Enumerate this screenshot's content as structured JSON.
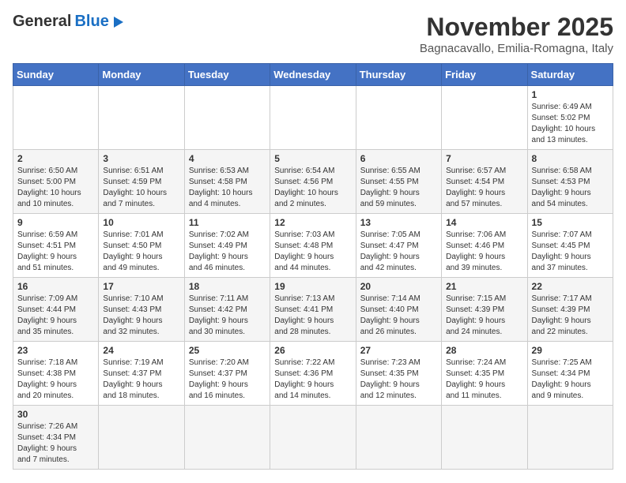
{
  "header": {
    "logo_general": "General",
    "logo_blue": "Blue",
    "month_year": "November 2025",
    "location": "Bagnacavallo, Emilia-Romagna, Italy"
  },
  "weekdays": [
    "Sunday",
    "Monday",
    "Tuesday",
    "Wednesday",
    "Thursday",
    "Friday",
    "Saturday"
  ],
  "weeks": [
    [
      {
        "day": "",
        "info": ""
      },
      {
        "day": "",
        "info": ""
      },
      {
        "day": "",
        "info": ""
      },
      {
        "day": "",
        "info": ""
      },
      {
        "day": "",
        "info": ""
      },
      {
        "day": "",
        "info": ""
      },
      {
        "day": "1",
        "info": "Sunrise: 6:49 AM\nSunset: 5:02 PM\nDaylight: 10 hours\nand 13 minutes."
      }
    ],
    [
      {
        "day": "2",
        "info": "Sunrise: 6:50 AM\nSunset: 5:00 PM\nDaylight: 10 hours\nand 10 minutes."
      },
      {
        "day": "3",
        "info": "Sunrise: 6:51 AM\nSunset: 4:59 PM\nDaylight: 10 hours\nand 7 minutes."
      },
      {
        "day": "4",
        "info": "Sunrise: 6:53 AM\nSunset: 4:58 PM\nDaylight: 10 hours\nand 4 minutes."
      },
      {
        "day": "5",
        "info": "Sunrise: 6:54 AM\nSunset: 4:56 PM\nDaylight: 10 hours\nand 2 minutes."
      },
      {
        "day": "6",
        "info": "Sunrise: 6:55 AM\nSunset: 4:55 PM\nDaylight: 9 hours\nand 59 minutes."
      },
      {
        "day": "7",
        "info": "Sunrise: 6:57 AM\nSunset: 4:54 PM\nDaylight: 9 hours\nand 57 minutes."
      },
      {
        "day": "8",
        "info": "Sunrise: 6:58 AM\nSunset: 4:53 PM\nDaylight: 9 hours\nand 54 minutes."
      }
    ],
    [
      {
        "day": "9",
        "info": "Sunrise: 6:59 AM\nSunset: 4:51 PM\nDaylight: 9 hours\nand 51 minutes."
      },
      {
        "day": "10",
        "info": "Sunrise: 7:01 AM\nSunset: 4:50 PM\nDaylight: 9 hours\nand 49 minutes."
      },
      {
        "day": "11",
        "info": "Sunrise: 7:02 AM\nSunset: 4:49 PM\nDaylight: 9 hours\nand 46 minutes."
      },
      {
        "day": "12",
        "info": "Sunrise: 7:03 AM\nSunset: 4:48 PM\nDaylight: 9 hours\nand 44 minutes."
      },
      {
        "day": "13",
        "info": "Sunrise: 7:05 AM\nSunset: 4:47 PM\nDaylight: 9 hours\nand 42 minutes."
      },
      {
        "day": "14",
        "info": "Sunrise: 7:06 AM\nSunset: 4:46 PM\nDaylight: 9 hours\nand 39 minutes."
      },
      {
        "day": "15",
        "info": "Sunrise: 7:07 AM\nSunset: 4:45 PM\nDaylight: 9 hours\nand 37 minutes."
      }
    ],
    [
      {
        "day": "16",
        "info": "Sunrise: 7:09 AM\nSunset: 4:44 PM\nDaylight: 9 hours\nand 35 minutes."
      },
      {
        "day": "17",
        "info": "Sunrise: 7:10 AM\nSunset: 4:43 PM\nDaylight: 9 hours\nand 32 minutes."
      },
      {
        "day": "18",
        "info": "Sunrise: 7:11 AM\nSunset: 4:42 PM\nDaylight: 9 hours\nand 30 minutes."
      },
      {
        "day": "19",
        "info": "Sunrise: 7:13 AM\nSunset: 4:41 PM\nDaylight: 9 hours\nand 28 minutes."
      },
      {
        "day": "20",
        "info": "Sunrise: 7:14 AM\nSunset: 4:40 PM\nDaylight: 9 hours\nand 26 minutes."
      },
      {
        "day": "21",
        "info": "Sunrise: 7:15 AM\nSunset: 4:39 PM\nDaylight: 9 hours\nand 24 minutes."
      },
      {
        "day": "22",
        "info": "Sunrise: 7:17 AM\nSunset: 4:39 PM\nDaylight: 9 hours\nand 22 minutes."
      }
    ],
    [
      {
        "day": "23",
        "info": "Sunrise: 7:18 AM\nSunset: 4:38 PM\nDaylight: 9 hours\nand 20 minutes."
      },
      {
        "day": "24",
        "info": "Sunrise: 7:19 AM\nSunset: 4:37 PM\nDaylight: 9 hours\nand 18 minutes."
      },
      {
        "day": "25",
        "info": "Sunrise: 7:20 AM\nSunset: 4:37 PM\nDaylight: 9 hours\nand 16 minutes."
      },
      {
        "day": "26",
        "info": "Sunrise: 7:22 AM\nSunset: 4:36 PM\nDaylight: 9 hours\nand 14 minutes."
      },
      {
        "day": "27",
        "info": "Sunrise: 7:23 AM\nSunset: 4:35 PM\nDaylight: 9 hours\nand 12 minutes."
      },
      {
        "day": "28",
        "info": "Sunrise: 7:24 AM\nSunset: 4:35 PM\nDaylight: 9 hours\nand 11 minutes."
      },
      {
        "day": "29",
        "info": "Sunrise: 7:25 AM\nSunset: 4:34 PM\nDaylight: 9 hours\nand 9 minutes."
      }
    ],
    [
      {
        "day": "30",
        "info": "Sunrise: 7:26 AM\nSunset: 4:34 PM\nDaylight: 9 hours\nand 7 minutes."
      },
      {
        "day": "",
        "info": ""
      },
      {
        "day": "",
        "info": ""
      },
      {
        "day": "",
        "info": ""
      },
      {
        "day": "",
        "info": ""
      },
      {
        "day": "",
        "info": ""
      },
      {
        "day": "",
        "info": ""
      }
    ]
  ]
}
